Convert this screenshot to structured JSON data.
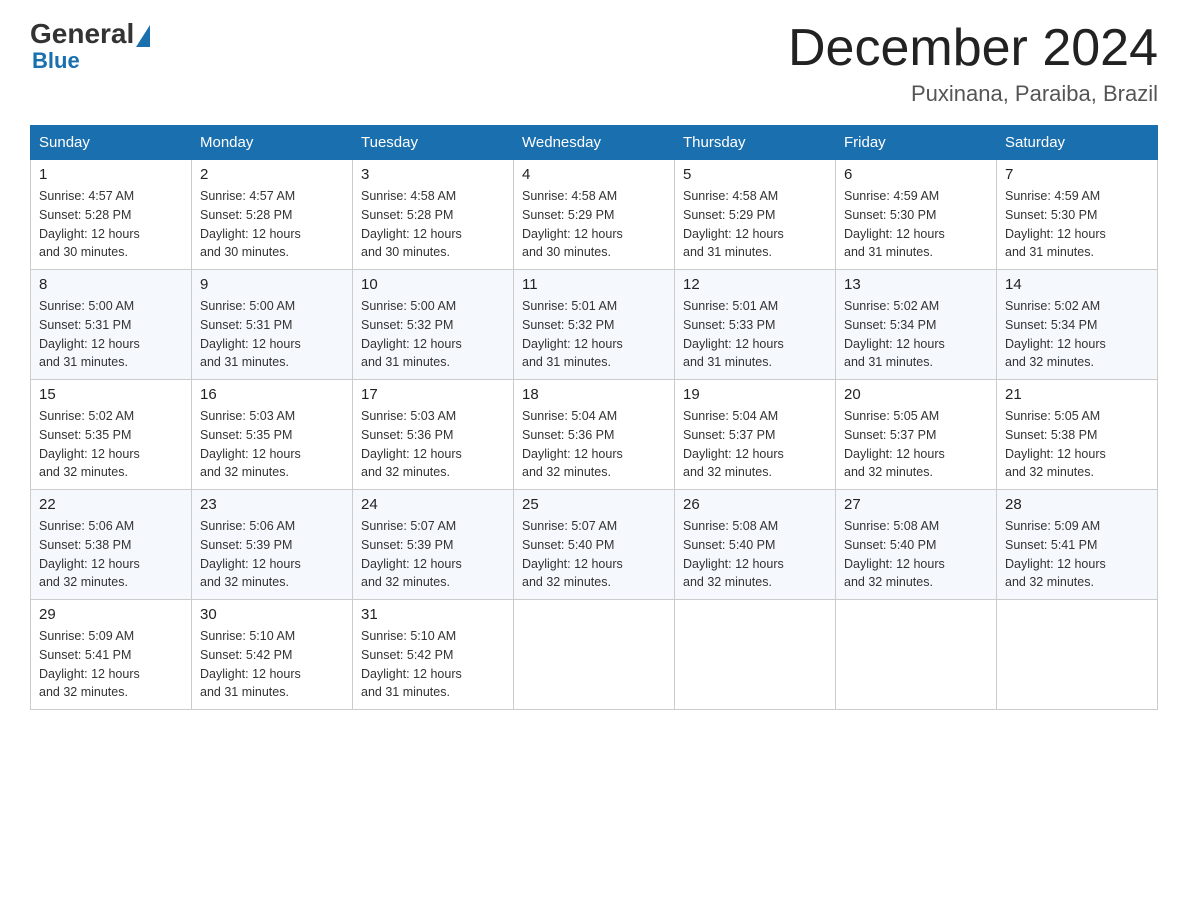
{
  "logo": {
    "general": "General",
    "blue": "Blue"
  },
  "title": "December 2024",
  "subtitle": "Puxinana, Paraiba, Brazil",
  "days_header": [
    "Sunday",
    "Monday",
    "Tuesday",
    "Wednesday",
    "Thursday",
    "Friday",
    "Saturday"
  ],
  "weeks": [
    [
      {
        "day": "1",
        "sunrise": "4:57 AM",
        "sunset": "5:28 PM",
        "daylight": "12 hours and 30 minutes."
      },
      {
        "day": "2",
        "sunrise": "4:57 AM",
        "sunset": "5:28 PM",
        "daylight": "12 hours and 30 minutes."
      },
      {
        "day": "3",
        "sunrise": "4:58 AM",
        "sunset": "5:28 PM",
        "daylight": "12 hours and 30 minutes."
      },
      {
        "day": "4",
        "sunrise": "4:58 AM",
        "sunset": "5:29 PM",
        "daylight": "12 hours and 30 minutes."
      },
      {
        "day": "5",
        "sunrise": "4:58 AM",
        "sunset": "5:29 PM",
        "daylight": "12 hours and 31 minutes."
      },
      {
        "day": "6",
        "sunrise": "4:59 AM",
        "sunset": "5:30 PM",
        "daylight": "12 hours and 31 minutes."
      },
      {
        "day": "7",
        "sunrise": "4:59 AM",
        "sunset": "5:30 PM",
        "daylight": "12 hours and 31 minutes."
      }
    ],
    [
      {
        "day": "8",
        "sunrise": "5:00 AM",
        "sunset": "5:31 PM",
        "daylight": "12 hours and 31 minutes."
      },
      {
        "day": "9",
        "sunrise": "5:00 AM",
        "sunset": "5:31 PM",
        "daylight": "12 hours and 31 minutes."
      },
      {
        "day": "10",
        "sunrise": "5:00 AM",
        "sunset": "5:32 PM",
        "daylight": "12 hours and 31 minutes."
      },
      {
        "day": "11",
        "sunrise": "5:01 AM",
        "sunset": "5:32 PM",
        "daylight": "12 hours and 31 minutes."
      },
      {
        "day": "12",
        "sunrise": "5:01 AM",
        "sunset": "5:33 PM",
        "daylight": "12 hours and 31 minutes."
      },
      {
        "day": "13",
        "sunrise": "5:02 AM",
        "sunset": "5:34 PM",
        "daylight": "12 hours and 31 minutes."
      },
      {
        "day": "14",
        "sunrise": "5:02 AM",
        "sunset": "5:34 PM",
        "daylight": "12 hours and 32 minutes."
      }
    ],
    [
      {
        "day": "15",
        "sunrise": "5:02 AM",
        "sunset": "5:35 PM",
        "daylight": "12 hours and 32 minutes."
      },
      {
        "day": "16",
        "sunrise": "5:03 AM",
        "sunset": "5:35 PM",
        "daylight": "12 hours and 32 minutes."
      },
      {
        "day": "17",
        "sunrise": "5:03 AM",
        "sunset": "5:36 PM",
        "daylight": "12 hours and 32 minutes."
      },
      {
        "day": "18",
        "sunrise": "5:04 AM",
        "sunset": "5:36 PM",
        "daylight": "12 hours and 32 minutes."
      },
      {
        "day": "19",
        "sunrise": "5:04 AM",
        "sunset": "5:37 PM",
        "daylight": "12 hours and 32 minutes."
      },
      {
        "day": "20",
        "sunrise": "5:05 AM",
        "sunset": "5:37 PM",
        "daylight": "12 hours and 32 minutes."
      },
      {
        "day": "21",
        "sunrise": "5:05 AM",
        "sunset": "5:38 PM",
        "daylight": "12 hours and 32 minutes."
      }
    ],
    [
      {
        "day": "22",
        "sunrise": "5:06 AM",
        "sunset": "5:38 PM",
        "daylight": "12 hours and 32 minutes."
      },
      {
        "day": "23",
        "sunrise": "5:06 AM",
        "sunset": "5:39 PM",
        "daylight": "12 hours and 32 minutes."
      },
      {
        "day": "24",
        "sunrise": "5:07 AM",
        "sunset": "5:39 PM",
        "daylight": "12 hours and 32 minutes."
      },
      {
        "day": "25",
        "sunrise": "5:07 AM",
        "sunset": "5:40 PM",
        "daylight": "12 hours and 32 minutes."
      },
      {
        "day": "26",
        "sunrise": "5:08 AM",
        "sunset": "5:40 PM",
        "daylight": "12 hours and 32 minutes."
      },
      {
        "day": "27",
        "sunrise": "5:08 AM",
        "sunset": "5:40 PM",
        "daylight": "12 hours and 32 minutes."
      },
      {
        "day": "28",
        "sunrise": "5:09 AM",
        "sunset": "5:41 PM",
        "daylight": "12 hours and 32 minutes."
      }
    ],
    [
      {
        "day": "29",
        "sunrise": "5:09 AM",
        "sunset": "5:41 PM",
        "daylight": "12 hours and 32 minutes."
      },
      {
        "day": "30",
        "sunrise": "5:10 AM",
        "sunset": "5:42 PM",
        "daylight": "12 hours and 31 minutes."
      },
      {
        "day": "31",
        "sunrise": "5:10 AM",
        "sunset": "5:42 PM",
        "daylight": "12 hours and 31 minutes."
      },
      null,
      null,
      null,
      null
    ]
  ],
  "labels": {
    "sunrise": "Sunrise:",
    "sunset": "Sunset:",
    "daylight": "Daylight:"
  }
}
